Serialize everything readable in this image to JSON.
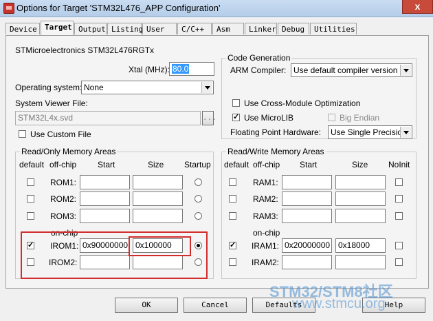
{
  "window": {
    "title": "Options for Target 'STM32L476_APP Configuration'",
    "close_label": "x"
  },
  "tabs": [
    "Device",
    "Target",
    "Output",
    "Listing",
    "User",
    "C/C++",
    "Asm",
    "Linker",
    "Debug",
    "Utilities"
  ],
  "device_name": "STMicroelectronics STM32L476RGTx",
  "xtal": {
    "label": "Xtal (MHz):",
    "value": "80.0"
  },
  "os": {
    "label": "Operating system:",
    "value": "None"
  },
  "svd": {
    "label": "System Viewer File:",
    "value": "STM32L4x.svd",
    "browse": "..."
  },
  "use_custom_file": {
    "label": "Use Custom File",
    "checked": false
  },
  "code_gen": {
    "title": "Code Generation",
    "compiler_label": "ARM Compiler:",
    "compiler_value": "Use default compiler version",
    "cross_module": {
      "label": "Use Cross-Module Optimization",
      "checked": false
    },
    "microlib": {
      "label": "Use MicroLIB",
      "checked": true
    },
    "big_endian": {
      "label": "Big Endian",
      "checked": false
    },
    "fp_label": "Floating Point Hardware:",
    "fp_value": "Use Single Precision"
  },
  "rom": {
    "title": "Read/Only Memory Areas",
    "headers": {
      "default": "default",
      "offchip": "off-chip",
      "start": "Start",
      "size": "Size",
      "extra": "Startup"
    },
    "onchip_label": "on-chip",
    "rows": [
      {
        "name": "ROM1:",
        "start": "",
        "size": "",
        "default": false,
        "startup": false
      },
      {
        "name": "ROM2:",
        "start": "",
        "size": "",
        "default": false,
        "startup": false
      },
      {
        "name": "ROM3:",
        "start": "",
        "size": "",
        "default": false,
        "startup": false
      },
      {
        "name": "IROM1:",
        "start": "0x90000000",
        "size": "0x100000",
        "default": true,
        "startup": true
      },
      {
        "name": "IROM2:",
        "start": "",
        "size": "",
        "default": false,
        "startup": false
      }
    ]
  },
  "ram": {
    "title": "Read/Write Memory Areas",
    "headers": {
      "default": "default",
      "offchip": "off-chip",
      "start": "Start",
      "size": "Size",
      "extra": "NoInit"
    },
    "onchip_label": "on-chip",
    "rows": [
      {
        "name": "RAM1:",
        "start": "",
        "size": "",
        "default": false,
        "noinit": false
      },
      {
        "name": "RAM2:",
        "start": "",
        "size": "",
        "default": false,
        "noinit": false
      },
      {
        "name": "RAM3:",
        "start": "",
        "size": "",
        "default": false,
        "noinit": false
      },
      {
        "name": "IRAM1:",
        "start": "0x20000000",
        "size": "0x18000",
        "default": true,
        "noinit": false
      },
      {
        "name": "IRAM2:",
        "start": "",
        "size": "",
        "default": false,
        "noinit": false
      }
    ]
  },
  "buttons": {
    "ok": "OK",
    "cancel": "Cancel",
    "defaults": "Defaults",
    "help": "Help"
  },
  "watermark": {
    "line1": "STM32/STM8社区",
    "line2": "www.stmcu.org"
  }
}
